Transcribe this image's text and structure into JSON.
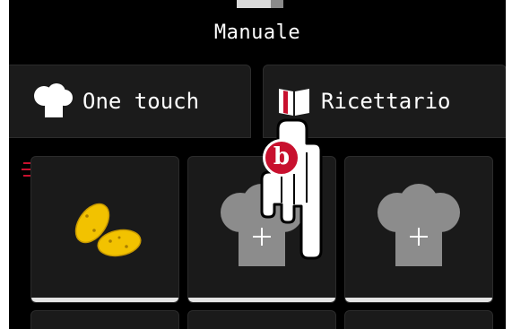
{
  "header": {
    "title": "Manuale"
  },
  "tabs": [
    {
      "label": "One touch",
      "icon": "chef-hat-icon",
      "selected": false
    },
    {
      "label": "Ricettario",
      "icon": "recipe-book-icon",
      "selected": true
    }
  ],
  "tiles": [
    {
      "icon": "potatoes-icon",
      "type": "program"
    },
    {
      "icon": "chef-hat-add-icon",
      "type": "add"
    },
    {
      "icon": "chef-hat-add-icon",
      "type": "add"
    }
  ],
  "overlay": {
    "badge_letter": "b",
    "pointer": "hand-pointer-icon"
  },
  "colors": {
    "background": "#000000",
    "tile": "#1a1a1a",
    "icon_gray": "#8c8c8c",
    "accent_red": "#c8102e",
    "potato_yellow": "#f2c200"
  }
}
